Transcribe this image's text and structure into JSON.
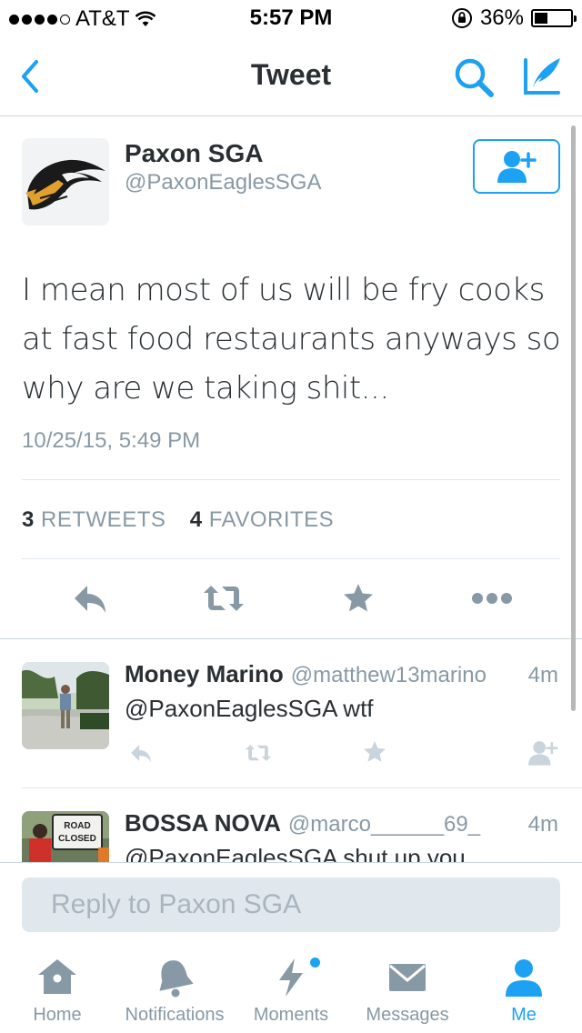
{
  "status_bar": {
    "carrier": "AT&T",
    "time": "5:57 PM",
    "battery": "36%",
    "battery_level": 0.36
  },
  "nav": {
    "title": "Tweet"
  },
  "tweet": {
    "author_name": "Paxon SGA",
    "author_handle": "@PaxonEaglesSGA",
    "text": "I mean most of us will be fry cooks at fast food restaurants anyways so why are we taking shit...",
    "timestamp": "10/25/15, 5:49 PM",
    "retweets_count": "3",
    "retweets_label": "RETWEETS",
    "favorites_count": "4",
    "favorites_label": "FAVORITES"
  },
  "replies": [
    {
      "name": "Money Marino",
      "handle": "@matthew13marino",
      "time": "4m",
      "text": "@PaxonEaglesSGA wtf"
    },
    {
      "name": "BOSSA NOVA",
      "handle": "@marco______69_",
      "time": "4m",
      "text": "@PaxonEaglesSGA shut up you",
      "avatar_sign": [
        "ROAD",
        "CLOSED"
      ]
    }
  ],
  "reply_box": {
    "placeholder": "Reply to Paxon SGA"
  },
  "tabs": [
    {
      "label": "Home",
      "icon": "home-icon",
      "active": false
    },
    {
      "label": "Notifications",
      "icon": "bell-icon",
      "active": false
    },
    {
      "label": "Moments",
      "icon": "lightning-icon",
      "active": false
    },
    {
      "label": "Messages",
      "icon": "envelope-icon",
      "active": false
    },
    {
      "label": "Me",
      "icon": "person-icon",
      "active": true
    }
  ],
  "colors": {
    "accent": "#1da1f2",
    "muted": "#8899a6",
    "text": "#292f33",
    "action_gray": "#8899a6"
  }
}
